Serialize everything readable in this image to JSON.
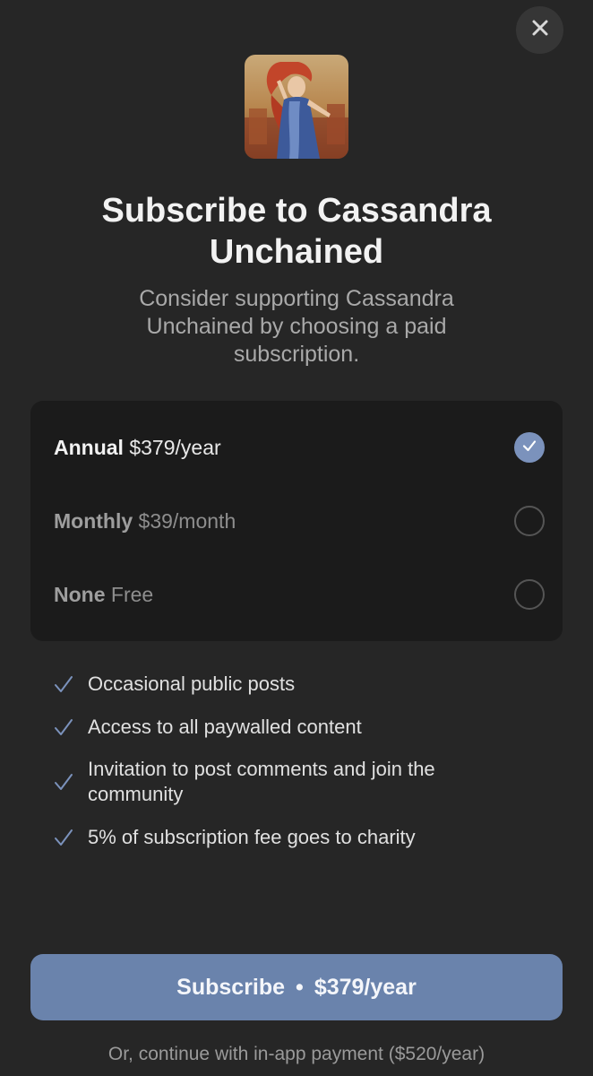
{
  "header": {
    "close_icon": "close-icon",
    "cover_image": "publication-cover-image"
  },
  "title": "Subscribe to Cassandra Unchained",
  "subtitle": "Consider supporting Cassandra Unchained by choosing a paid subscription.",
  "plans": [
    {
      "name": "Annual",
      "price": "$379/year",
      "selected": true
    },
    {
      "name": "Monthly",
      "price": "$39/month",
      "selected": false
    },
    {
      "name": "None",
      "price": "Free",
      "selected": false
    }
  ],
  "benefits": [
    "Occasional public posts",
    "Access to all paywalled content",
    "Invitation to post comments and join the community",
    "5% of subscription fee goes to charity"
  ],
  "subscribe": {
    "label": "Subscribe",
    "separator": "•",
    "price": "$379/year"
  },
  "alt_payment": "Or, continue with in-app payment ($520/year)",
  "colors": {
    "background": "#262626",
    "card": "#1b1b1b",
    "accent": "#7b92bc",
    "button": "#6a83ac"
  }
}
